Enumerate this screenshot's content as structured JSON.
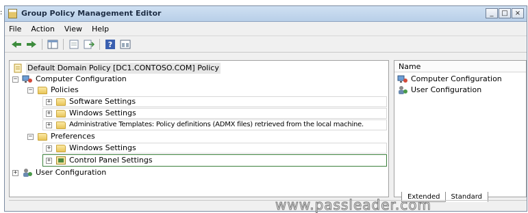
{
  "window": {
    "title": "Group Policy Management Editor",
    "caption_buttons": [
      "_",
      "□",
      "×"
    ]
  },
  "menu": [
    "File",
    "Action",
    "View",
    "Help"
  ],
  "toolbar": {
    "icons": [
      "back-arrow-icon",
      "forward-arrow-icon",
      "show-hide-tree-icon",
      "properties-icon",
      "export-list-icon",
      "help-icon",
      "view-icon"
    ]
  },
  "tree": {
    "root": "Default Domain Policy [DC1.CONTOSO.COM] Policy",
    "computer_config": "Computer Configuration",
    "policies": "Policies",
    "policies_children": [
      "Software Settings",
      "Windows Settings",
      "Administrative Templates: Policy definitions (ADMX files) retrieved from the local machine."
    ],
    "preferences": "Preferences",
    "preferences_children": [
      "Windows Settings",
      "Control Panel Settings"
    ],
    "user_config": "User Configuration"
  },
  "details": {
    "column_header": "Name",
    "items": [
      "Computer Configuration",
      "User Configuration"
    ],
    "tabs": [
      "Extended",
      "Standard"
    ]
  },
  "watermark": "www.passleader.com"
}
